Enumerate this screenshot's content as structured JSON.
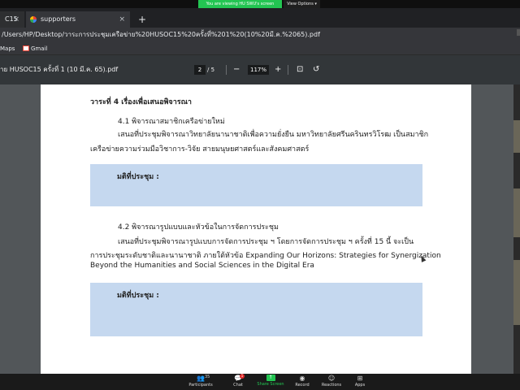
{
  "zoom_top": {
    "sharing_banner": "You are viewing HU SWU's screen",
    "view_options": "View Options"
  },
  "browser": {
    "tabs": [
      {
        "label": "C15"
      },
      {
        "label": "supporters"
      }
    ],
    "address": "/Users/HP/Desktop/วาระการประชุมเครือข่าย%20HUSOC15%20ครั้งที่%201%20(10%20มี.ค.%2065).pdf",
    "bookmarks": [
      {
        "label": "Maps"
      },
      {
        "label": "Gmail"
      }
    ]
  },
  "pdf_toolbar": {
    "title": "าย HUSOC15 ครั้งที่ 1 (10 มี.ค. 65).pdf",
    "current_page": "2",
    "page_sep": "/",
    "total_pages": "5",
    "zoom": "117%"
  },
  "document": {
    "agenda_heading": "วาระที่ 4 เรื่องเพื่อเสนอพิจารณา",
    "item1_title": "4.1 พิจารณาสมาชิกเครือข่ายใหม่",
    "item1_line1": "เสนอที่ประชุมพิจารณาวิทยาลัยนานาชาติเพื่อความยั่งยืน มหาวิทยาลัยศรีนครินทรวิโรฒ เป็นสมาชิก",
    "item1_line2": "เครือข่ายความร่วมมือวิชาการ-วิจัย สายมนุษยศาสตร์และสังคมศาสตร์",
    "resolution_label_1": "มติที่ประชุม :",
    "item2_title": "4.2 พิจารณารูปแบบและหัวข้อในการจัดการประชุม",
    "item2_line1": "เสนอที่ประชุมพิจารณารูปแบบการจัดการประชุม ฯ โดยการจัดการประชุม ฯ ครั้งที่ 15 นี้ จะเป็น",
    "item2_line2": "การประชุมระดับชาติและนานาชาติ ภายใต้หัวข้อ Expanding Our Horizons: Strategies for Synergization",
    "item2_line3": "Beyond the Humanities and Social Sciences in the Digital Era",
    "resolution_label_2": "มติที่ประชุม :"
  },
  "zoom_bar": {
    "participants_label": "Participants",
    "participants_count": "35",
    "chat_label": "Chat",
    "chat_badge": "1",
    "share_label": "Share Screen",
    "record_label": "Record",
    "reactions_label": "Reactions",
    "apps_label": "Apps"
  },
  "colors": {
    "share_green": "#23c552",
    "resolution_box": "#c5d8ef",
    "pdf_toolbar": "#323639"
  }
}
